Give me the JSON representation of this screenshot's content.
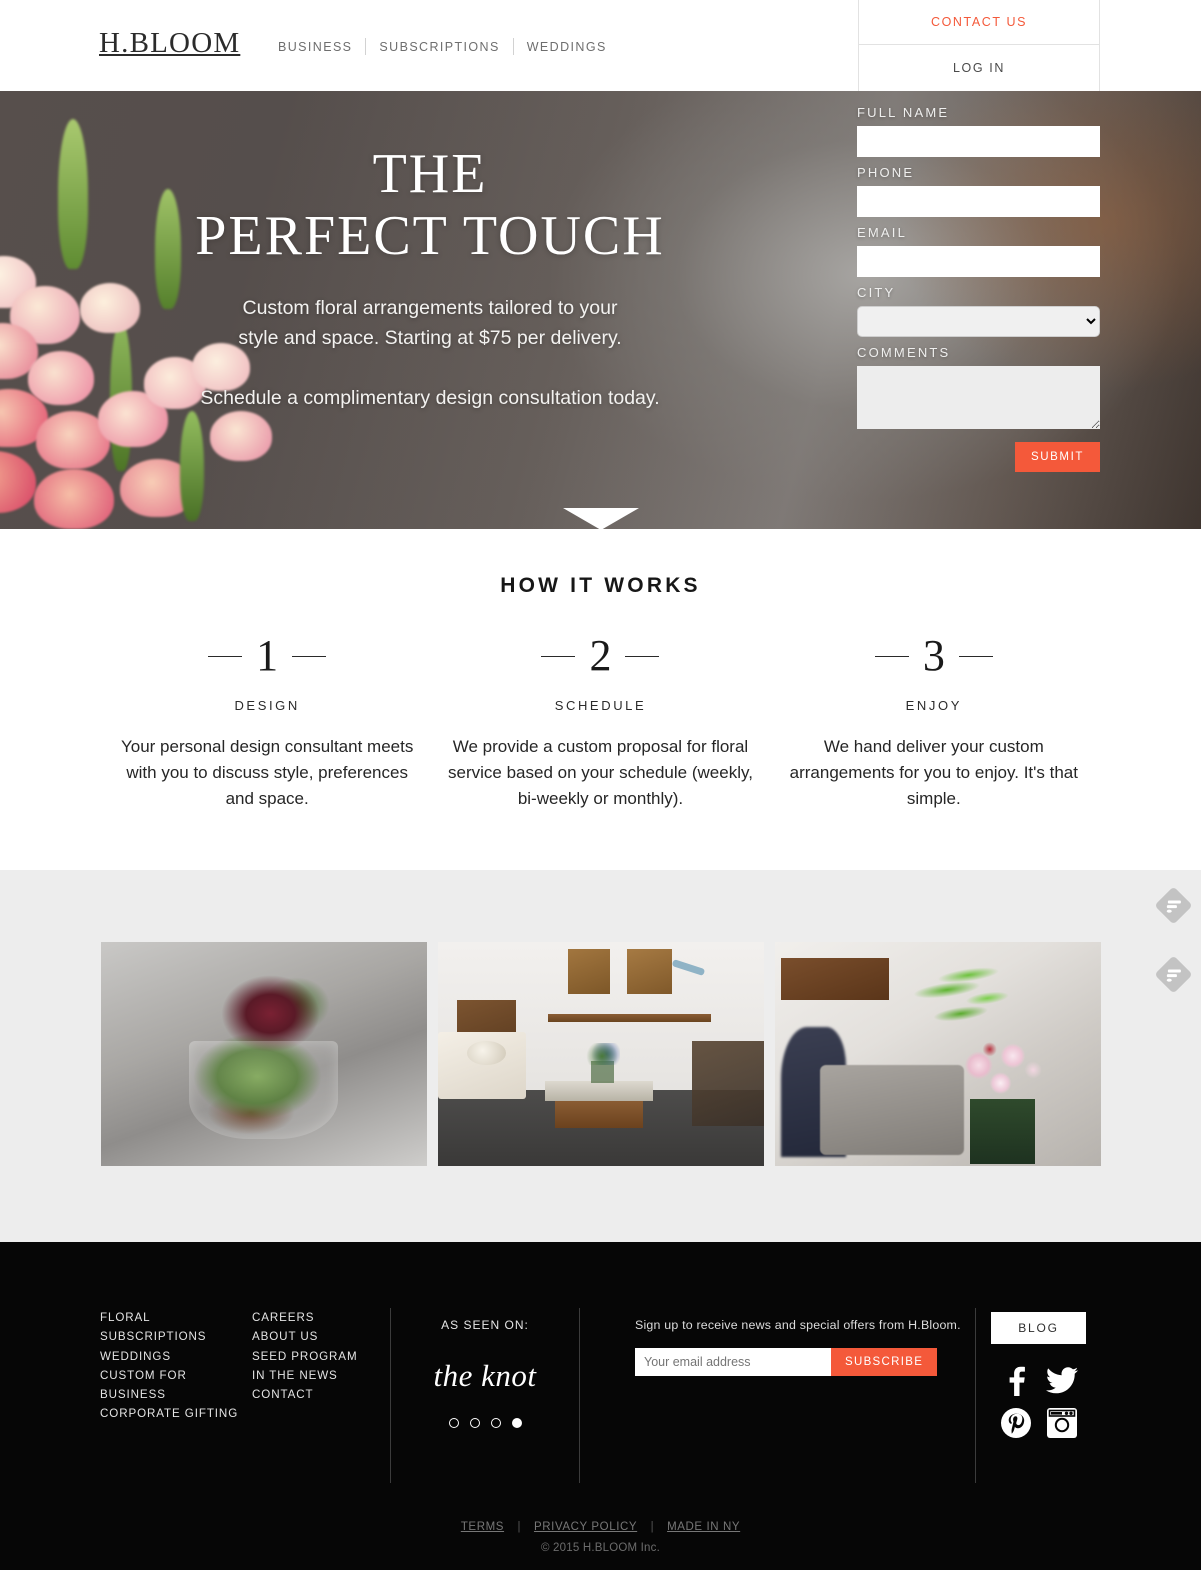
{
  "brand": {
    "logo": "H.BLOOM"
  },
  "header": {
    "nav": [
      {
        "label": "BUSINESS"
      },
      {
        "label": "SUBSCRIPTIONS"
      },
      {
        "label": "WEDDINGS"
      }
    ],
    "contact_us": "CONTACT US",
    "log_in": "LOG IN",
    "accent_color": "#f4593a"
  },
  "hero": {
    "headline_line1": "THE",
    "headline_line2": "PERFECT TOUCH",
    "sub_line1": "Custom floral arrangements tailored to your",
    "sub_line2": "style and space. Starting at $75 per delivery.",
    "sub_line3": "Schedule a complimentary design consultation today.",
    "form": {
      "full_name_label": "FULL NAME",
      "full_name_value": "",
      "full_name_placeholder": "",
      "phone_label": "PHONE",
      "phone_value": "",
      "phone_placeholder": "",
      "email_label": "EMAIL",
      "email_value": "",
      "email_placeholder": "",
      "city_label": "CITY",
      "city_selected": "",
      "comments_label": "COMMENTS",
      "comments_value": "",
      "comments_placeholder": "",
      "submit_label": "SUBMIT",
      "submit_color": "#f4593a"
    }
  },
  "how_it_works": {
    "title": "HOW IT WORKS",
    "steps": [
      {
        "number": "1",
        "label": "DESIGN",
        "desc": "Your personal design consultant meets with you to discuss style, preferences and space."
      },
      {
        "number": "2",
        "label": "SCHEDULE",
        "desc": "We provide a custom proposal for floral service based on your schedule (weekly, bi-weekly or monthly)."
      },
      {
        "number": "3",
        "label": "ENJOY",
        "desc": "We hand deliver your custom arrangements for you to enjoy. It's that simple."
      }
    ]
  },
  "gallery": {
    "background_color": "#ededed",
    "items": [
      {
        "alt": "succulent arrangement in glass vessel"
      },
      {
        "alt": "loft living room with flowers on coffee table"
      },
      {
        "alt": "orchid and fern arrangement in green glass vase"
      }
    ],
    "side_tabs": [
      {
        "icon": "feed-share-icon"
      },
      {
        "icon": "feed-share-icon"
      }
    ]
  },
  "footer": {
    "links_col1": [
      {
        "label": "FLORAL SUBSCRIPTIONS"
      },
      {
        "label": "WEDDINGS"
      },
      {
        "label": "CUSTOM FOR BUSINESS"
      },
      {
        "label": "CORPORATE GIFTING"
      }
    ],
    "links_col2": [
      {
        "label": "CAREERS"
      },
      {
        "label": "ABOUT US"
      },
      {
        "label": "SEED PROGRAM"
      },
      {
        "label": "IN THE NEWS"
      },
      {
        "label": "CONTACT"
      }
    ],
    "as_seen_on_label": "AS SEEN ON:",
    "as_seen_on_logo": "the knot",
    "carousel_dots": 4,
    "carousel_active_index": 3,
    "newsletter": {
      "text": "Sign up to receive news and special offers from H.Bloom.",
      "email_value": "",
      "email_placeholder": "Your email address",
      "subscribe_label": "SUBSCRIBE",
      "subscribe_color": "#f4593a"
    },
    "blog_label": "BLOG",
    "social": [
      {
        "name": "facebook-icon"
      },
      {
        "name": "twitter-icon"
      },
      {
        "name": "pinterest-icon"
      },
      {
        "name": "instagram-icon"
      }
    ],
    "legal": [
      {
        "label": "TERMS"
      },
      {
        "label": "PRIVACY POLICY"
      },
      {
        "label": "MADE IN NY"
      }
    ],
    "legal_separator": "|",
    "copyright": "© 2015 H.BLOOM Inc."
  }
}
